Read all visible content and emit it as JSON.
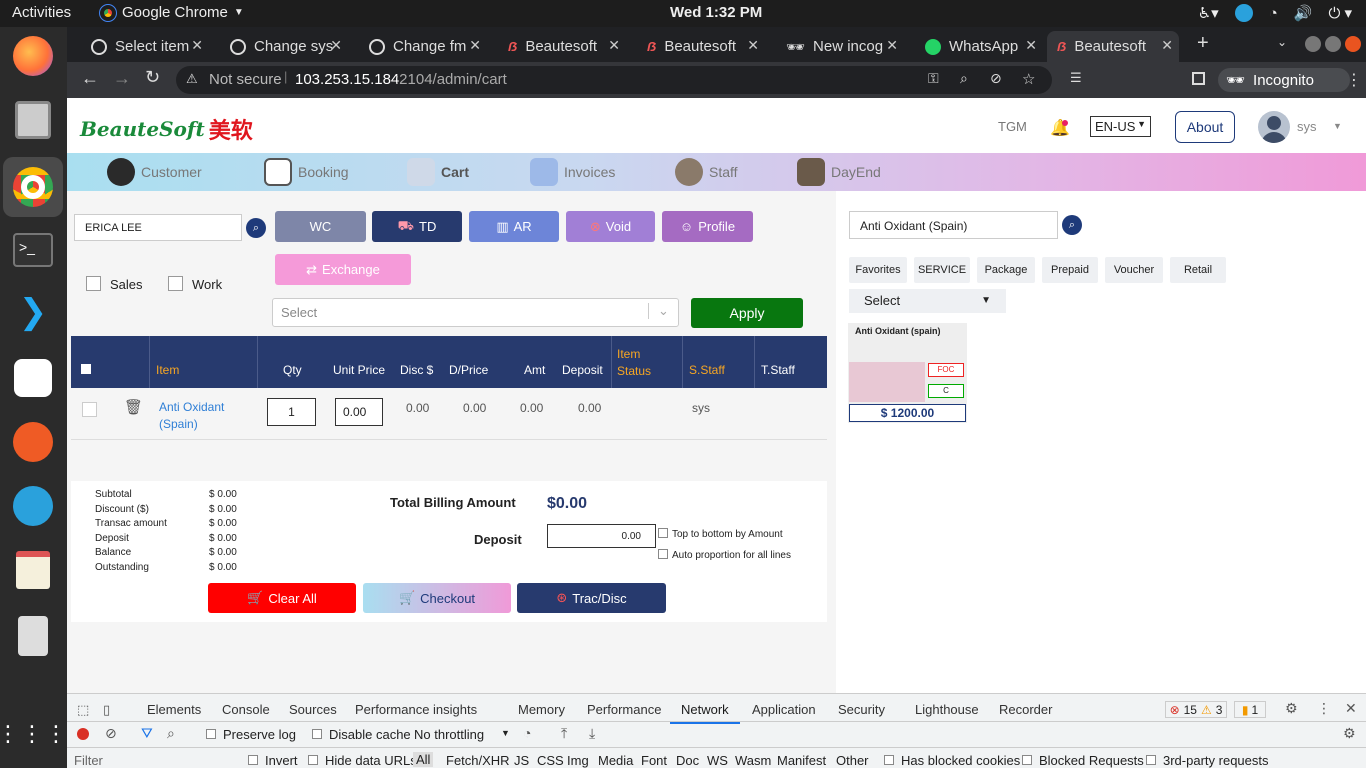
{
  "os": {
    "activities": "Activities",
    "app_name": "Google Chrome",
    "clock": "Wed  1:32 PM"
  },
  "tabs": [
    {
      "label": "Select item"
    },
    {
      "label": "Change sys"
    },
    {
      "label": "Change fm"
    },
    {
      "label": "Beautesoft"
    },
    {
      "label": "Beautesoft"
    },
    {
      "label": "New incog"
    },
    {
      "label": "WhatsApp"
    },
    {
      "label": "Beautesoft"
    }
  ],
  "address": {
    "security": "Not secure",
    "host": "103.253.15.184",
    "path": ":2104/admin/cart",
    "profile": "Incognito"
  },
  "header": {
    "logo": "BeauteSoft",
    "logo_cn": "美软",
    "tgm": "TGM",
    "language": "EN-US",
    "about": "About",
    "user": "sys"
  },
  "nav": [
    "Customer",
    "Booking",
    "Cart",
    "Invoices",
    "Staff",
    "DayEnd"
  ],
  "cart": {
    "customer": "ERICA LEE",
    "buttons": {
      "wc": "WC",
      "td": "TD",
      "ar": "AR",
      "void": "Void",
      "profile": "Profile",
      "exchange": "Exchange",
      "apply": "Apply"
    },
    "checks": {
      "sales": "Sales",
      "work": "Work"
    },
    "select_placeholder": "Select",
    "columns": [
      "Item",
      "Qty",
      "Unit Price",
      "Disc $",
      "D/Price",
      "Amt",
      "Deposit",
      "Item Status",
      "S.Staff",
      "T.Staff"
    ],
    "row": {
      "item": "Anti Oxidant (Spain)",
      "qty": "1",
      "unit_price": "0.00",
      "disc": "0.00",
      "dprice": "0.00",
      "amt": "0.00",
      "deposit": "0.00",
      "sstaff": "sys"
    }
  },
  "summary": {
    "labels": [
      "Subtotal",
      "Discount ($)",
      "Transac amount",
      "Deposit",
      "Balance",
      "Outstanding"
    ],
    "values": [
      "$ 0.00",
      "$ 0.00",
      "$ 0.00",
      "$ 0.00",
      "$ 0.00",
      "$ 0.00"
    ],
    "total_label": "Total Billing Amount",
    "total": "$0.00",
    "deposit_label": "Deposit",
    "deposit_value": "0.00",
    "opt1": "Top to bottom by Amount",
    "opt2": "Auto proportion for all lines",
    "clear": "Clear All",
    "checkout": "Checkout",
    "trac": "Trac/Disc"
  },
  "catalog": {
    "search": "Anti Oxidant (Spain)",
    "categories": [
      "Favorites",
      "SERVICE",
      "Package",
      "Prepaid",
      "Voucher",
      "Retail"
    ],
    "select": "Select",
    "product": {
      "name": "Anti Oxidant (spain)",
      "foc": "FOC",
      "c": "C",
      "price": "$ 1200.00"
    }
  },
  "devtools": {
    "tabs": [
      "Elements",
      "Console",
      "Sources",
      "Performance insights",
      "Memory",
      "Performance",
      "Network",
      "Application",
      "Security",
      "Lighthouse",
      "Recorder"
    ],
    "errors": "15",
    "warnings": "3",
    "issues": "1",
    "preserve": "Preserve log",
    "disable_cache": "Disable cache",
    "throttle": "No throttling",
    "filter": "Filter",
    "invert": "Invert",
    "hide_urls": "Hide data URLs",
    "types": [
      "All",
      "Fetch/XHR",
      "JS",
      "CSS",
      "Img",
      "Media",
      "Font",
      "Doc",
      "WS",
      "Wasm",
      "Manifest",
      "Other"
    ],
    "blocked_cookies": "Has blocked cookies",
    "blocked_req": "Blocked Requests",
    "third": "3rd-party requests"
  }
}
